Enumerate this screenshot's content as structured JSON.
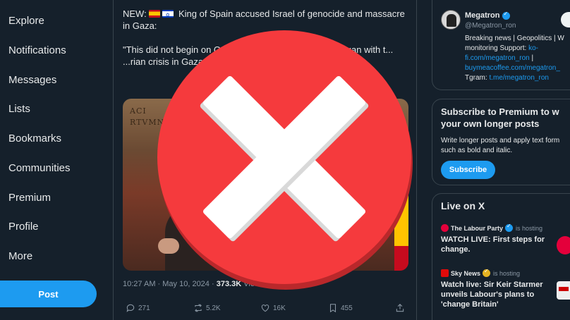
{
  "nav": {
    "items": [
      {
        "label": "Explore",
        "icon": "explore-icon"
      },
      {
        "label": "Notifications",
        "icon": "bell-icon"
      },
      {
        "label": "Messages",
        "icon": "mail-icon"
      },
      {
        "label": "Lists",
        "icon": "list-icon"
      },
      {
        "label": "Bookmarks",
        "icon": "bookmark-icon"
      },
      {
        "label": "Communities",
        "icon": "people-icon"
      },
      {
        "label": "Premium",
        "icon": "x-logo-icon"
      },
      {
        "label": "Profile",
        "icon": "person-icon"
      },
      {
        "label": "More",
        "icon": "more-icon"
      }
    ],
    "post_label": "Post"
  },
  "tweet": {
    "headline_prefix": "NEW:",
    "headline_rest": "King of Spain accused Israel of genocide and massacre in Gaza:",
    "flags": [
      "spain-flag-icon",
      "israel-flag-icon"
    ],
    "quote": "\"This did not begin on Oct... ...escalation of violence began with t... ...rian crisis in Gaza. It has alr... ...est concern to eve...",
    "image_inscription_1": "ACI",
    "image_inscription_2": "RTVMNVS",
    "time": "10:27 AM",
    "date": "May 10, 2024",
    "views_count": "373.3K",
    "views_label": "Views",
    "actions": {
      "replies": "271",
      "reposts": "5.2K",
      "likes": "16K",
      "bookmarks": "455"
    }
  },
  "sidebar": {
    "profile": {
      "name": "Megatron",
      "handle": "@Megatron_ron",
      "bio_1": "Breaking news | Geopolitics | W",
      "bio_2": "monitoring Support:",
      "link_1": "ko-fi.com/megatron_ron",
      "bio_sep": "|",
      "link_2": "buymeacoffee.com/megatron_",
      "bio_3": "Tgram:",
      "link_3": "t.me/megatron_ron"
    },
    "premium": {
      "title": "Subscribe to Premium to w your own longer posts",
      "description": "Write longer posts and apply text form such as bold and italic.",
      "button": "Subscribe"
    },
    "live": {
      "title": "Live on X",
      "items": [
        {
          "host": "The Labour Party",
          "status": "is hosting",
          "headline": "WATCH LIVE: First steps for change."
        },
        {
          "host": "Sky News",
          "status": "is hosting",
          "headline": "Watch live: Sir Keir Starmer unveils Labour's plans to 'change Britain'"
        }
      ]
    }
  },
  "colors": {
    "background": "#15202b",
    "accent": "#1d9bf0",
    "overlay_red": "#f53a3d"
  }
}
